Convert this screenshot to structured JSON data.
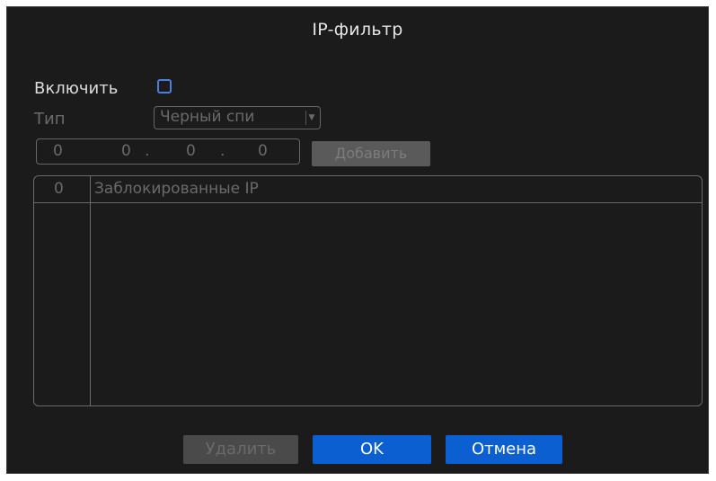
{
  "dialog": {
    "title": "IP-фильтр"
  },
  "enable": {
    "label": "Включить",
    "checked": false
  },
  "type": {
    "label": "Тип",
    "selected": "Черный спи"
  },
  "ip_input": {
    "octets": [
      "0",
      "0",
      "0",
      "0"
    ]
  },
  "add_button": {
    "label": "Добавить"
  },
  "blocked_list": {
    "count": "0",
    "header": "Заблокированные IP",
    "rows": []
  },
  "footer": {
    "delete_label": "Удалить",
    "ok_label": "OK",
    "cancel_label": "Отмена"
  },
  "colors": {
    "background": "#1b1b1b",
    "accent": "#0b5fd1",
    "checkbox_border": "#4a7fe0"
  }
}
